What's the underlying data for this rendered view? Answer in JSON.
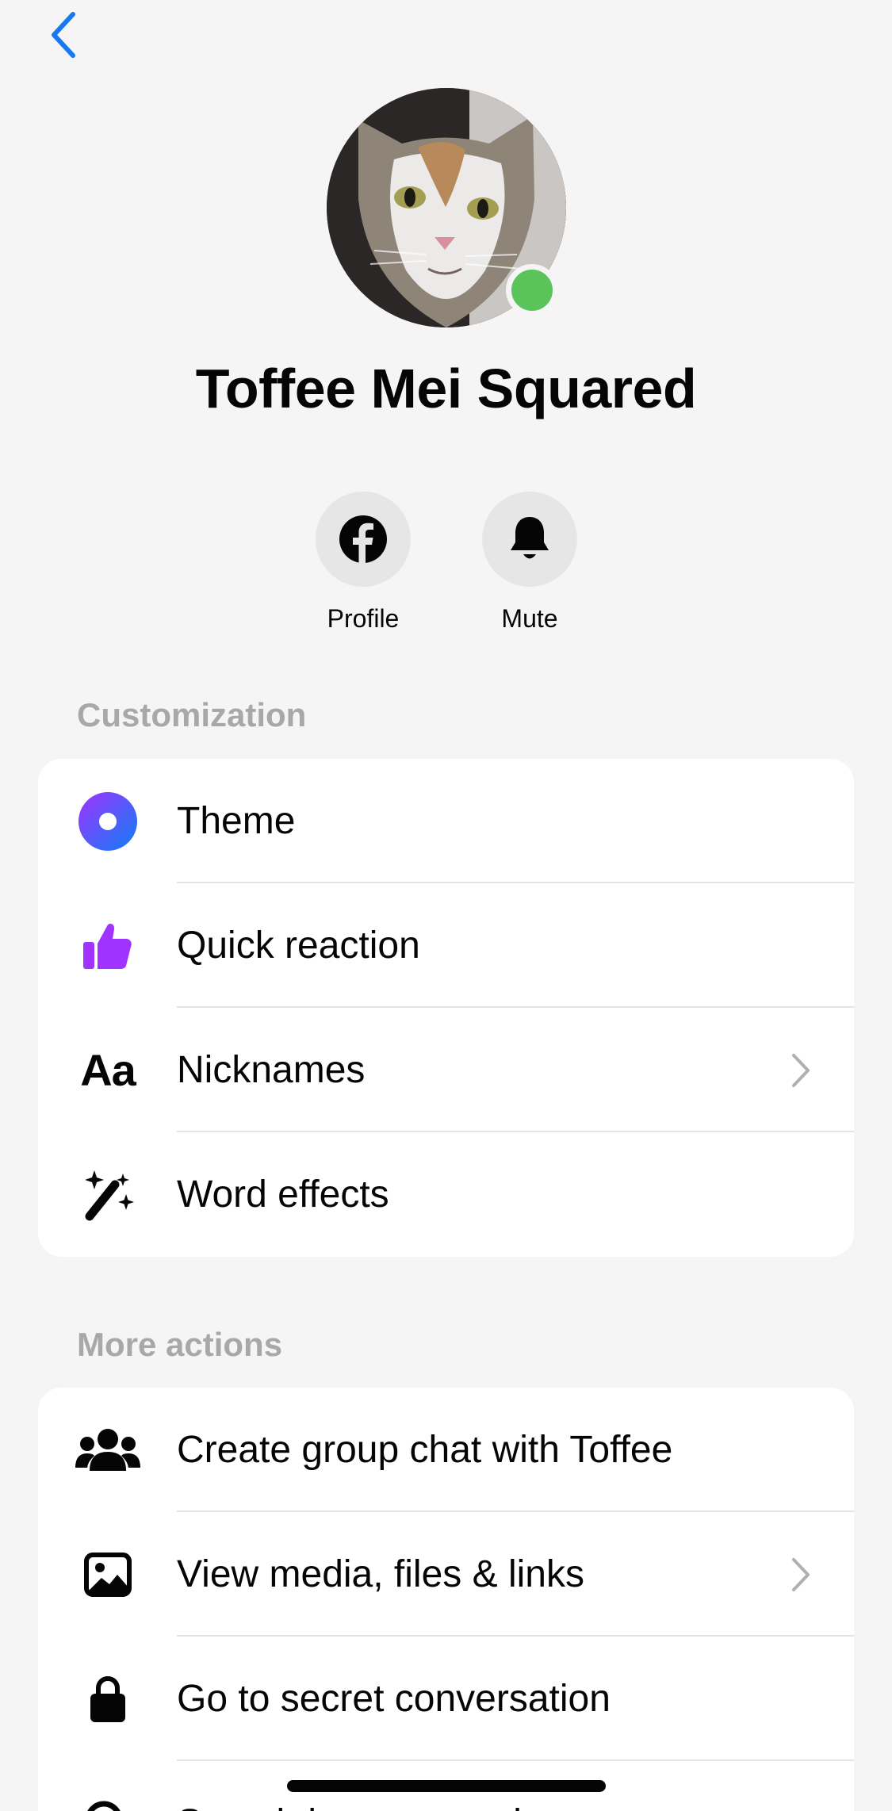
{
  "contact": {
    "name": "Toffee Mei Squared",
    "online": true
  },
  "actions": [
    {
      "label": "Profile",
      "icon": "facebook-icon"
    },
    {
      "label": "Mute",
      "icon": "bell-icon"
    }
  ],
  "customization": {
    "title": "Customization",
    "items": [
      {
        "label": "Theme",
        "icon": "theme-icon",
        "chevron": false
      },
      {
        "label": "Quick reaction",
        "icon": "thumbs-up-icon",
        "chevron": false
      },
      {
        "label": "Nicknames",
        "icon": "text-aa-icon",
        "chevron": true
      },
      {
        "label": "Word effects",
        "icon": "magic-wand-icon",
        "chevron": false
      }
    ]
  },
  "more_actions": {
    "title": "More actions",
    "items": [
      {
        "label": "Create group chat with Toffee",
        "icon": "people-icon",
        "chevron": false
      },
      {
        "label": "View media, files & links",
        "icon": "image-icon",
        "chevron": true
      },
      {
        "label": "Go to secret conversation",
        "icon": "lock-icon",
        "chevron": false
      },
      {
        "label": "Search in conversation",
        "icon": "search-icon",
        "chevron": false
      }
    ]
  },
  "colors": {
    "accent": "#1877f2",
    "presence": "#5ac35a",
    "theme_gradient_start": "#a033ff",
    "theme_gradient_end": "#0f7ff5",
    "reaction": "#a033ff"
  }
}
